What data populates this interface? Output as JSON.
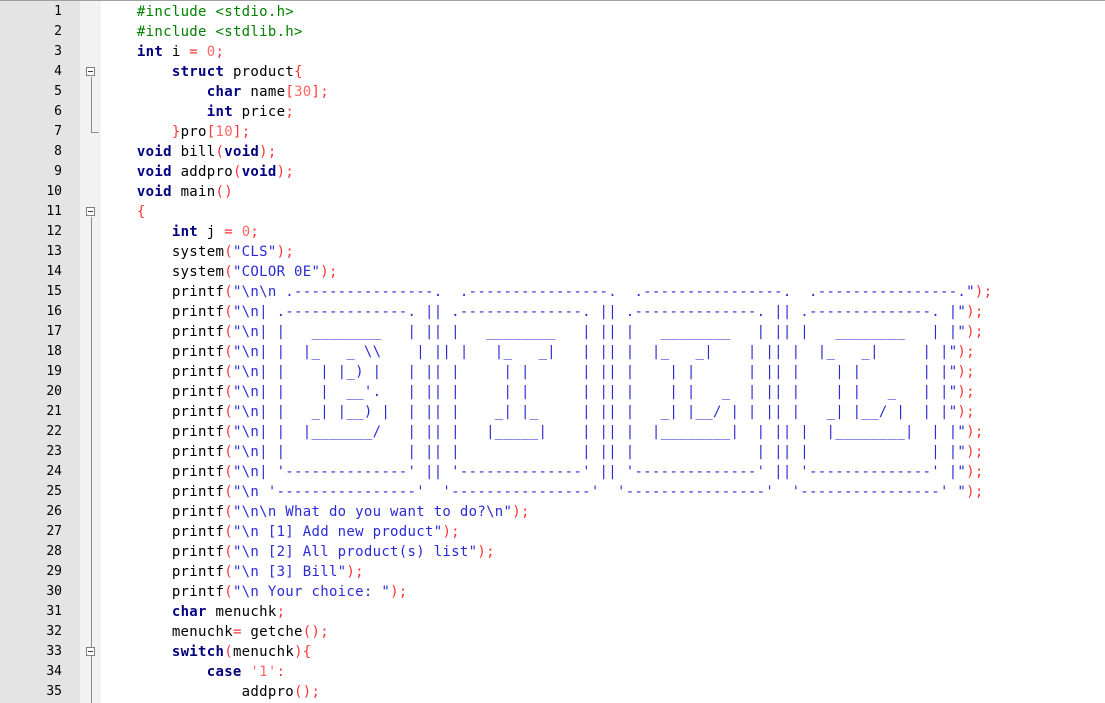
{
  "editor": {
    "lines": [
      {
        "n": "1",
        "tokens": [
          {
            "t": "    "
          },
          {
            "t": "#include <stdio.h>",
            "c": "pp"
          }
        ]
      },
      {
        "n": "2",
        "tokens": [
          {
            "t": "    "
          },
          {
            "t": "#include <stdlib.h>",
            "c": "pp"
          }
        ]
      },
      {
        "n": "3",
        "tokens": [
          {
            "t": "    "
          },
          {
            "t": "int",
            "c": "kw"
          },
          {
            "t": " i "
          },
          {
            "t": "=",
            "c": "op"
          },
          {
            "t": " "
          },
          {
            "t": "0",
            "c": "num"
          },
          {
            "t": ";",
            "c": "op"
          }
        ]
      },
      {
        "n": "4",
        "tokens": [
          {
            "t": "        "
          },
          {
            "t": "struct",
            "c": "kw"
          },
          {
            "t": " product"
          },
          {
            "t": "{",
            "c": "op"
          }
        ]
      },
      {
        "n": "5",
        "tokens": [
          {
            "t": "            "
          },
          {
            "t": "char",
            "c": "kw"
          },
          {
            "t": " name"
          },
          {
            "t": "[",
            "c": "op"
          },
          {
            "t": "30",
            "c": "num"
          },
          {
            "t": "];",
            "c": "op"
          }
        ]
      },
      {
        "n": "6",
        "tokens": [
          {
            "t": "            "
          },
          {
            "t": "int",
            "c": "kw"
          },
          {
            "t": " price"
          },
          {
            "t": ";",
            "c": "op"
          }
        ]
      },
      {
        "n": "7",
        "tokens": [
          {
            "t": "        "
          },
          {
            "t": "}",
            "c": "op"
          },
          {
            "t": "pro"
          },
          {
            "t": "[",
            "c": "op"
          },
          {
            "t": "10",
            "c": "num"
          },
          {
            "t": "];",
            "c": "op"
          }
        ]
      },
      {
        "n": "8",
        "tokens": [
          {
            "t": "    "
          },
          {
            "t": "void",
            "c": "kw"
          },
          {
            "t": " bill"
          },
          {
            "t": "(",
            "c": "op"
          },
          {
            "t": "void",
            "c": "kw"
          },
          {
            "t": ");",
            "c": "op"
          }
        ]
      },
      {
        "n": "9",
        "tokens": [
          {
            "t": "    "
          },
          {
            "t": "void",
            "c": "kw"
          },
          {
            "t": " addpro"
          },
          {
            "t": "(",
            "c": "op"
          },
          {
            "t": "void",
            "c": "kw"
          },
          {
            "t": ");",
            "c": "op"
          }
        ]
      },
      {
        "n": "10",
        "tokens": [
          {
            "t": "    "
          },
          {
            "t": "void",
            "c": "kw"
          },
          {
            "t": " main"
          },
          {
            "t": "()",
            "c": "op"
          }
        ]
      },
      {
        "n": "11",
        "tokens": [
          {
            "t": "    "
          },
          {
            "t": "{",
            "c": "op"
          }
        ]
      },
      {
        "n": "12",
        "tokens": [
          {
            "t": "        "
          },
          {
            "t": "int",
            "c": "kw"
          },
          {
            "t": " j "
          },
          {
            "t": "=",
            "c": "op"
          },
          {
            "t": " "
          },
          {
            "t": "0",
            "c": "num"
          },
          {
            "t": ";",
            "c": "op"
          }
        ]
      },
      {
        "n": "13",
        "tokens": [
          {
            "t": "        system"
          },
          {
            "t": "(",
            "c": "op"
          },
          {
            "t": "\"CLS\"",
            "c": "str"
          },
          {
            "t": ");",
            "c": "op"
          }
        ]
      },
      {
        "n": "14",
        "tokens": [
          {
            "t": "        system"
          },
          {
            "t": "(",
            "c": "op"
          },
          {
            "t": "\"COLOR 0E\"",
            "c": "str"
          },
          {
            "t": ");",
            "c": "op"
          }
        ]
      },
      {
        "n": "15",
        "tokens": [
          {
            "t": "        printf"
          },
          {
            "t": "(",
            "c": "op"
          },
          {
            "t": "\"\\n\\n .----------------.  .----------------.  .----------------.  .----------------.\"",
            "c": "str"
          },
          {
            "t": ");",
            "c": "op"
          }
        ]
      },
      {
        "n": "16",
        "tokens": [
          {
            "t": "        printf"
          },
          {
            "t": "(",
            "c": "op"
          },
          {
            "t": "\"\\n| .--------------. || .--------------. || .--------------. || .--------------. |\"",
            "c": "str"
          },
          {
            "t": ");",
            "c": "op"
          }
        ]
      },
      {
        "n": "17",
        "tokens": [
          {
            "t": "        printf"
          },
          {
            "t": "(",
            "c": "op"
          },
          {
            "t": "\"\\n| |   ________   | || |   ________   | || |   ________   | || |   ________   | |\"",
            "c": "str"
          },
          {
            "t": ");",
            "c": "op"
          }
        ]
      },
      {
        "n": "18",
        "tokens": [
          {
            "t": "        printf"
          },
          {
            "t": "(",
            "c": "op"
          },
          {
            "t": "\"\\n| |  |_   _ \\\\    | || |   |_   _|   | || |  |_   _|    | || |  |_   _|     | |\"",
            "c": "str"
          },
          {
            "t": ");",
            "c": "op"
          }
        ]
      },
      {
        "n": "19",
        "tokens": [
          {
            "t": "        printf"
          },
          {
            "t": "(",
            "c": "op"
          },
          {
            "t": "\"\\n| |    | |_) |   | || |     | |      | || |    | |      | || |    | |       | |\"",
            "c": "str"
          },
          {
            "t": ");",
            "c": "op"
          }
        ]
      },
      {
        "n": "20",
        "tokens": [
          {
            "t": "        printf"
          },
          {
            "t": "(",
            "c": "op"
          },
          {
            "t": "\"\\n| |    |  __'.   | || |     | |      | || |    | |   _  | || |    | |   _   | |\"",
            "c": "str"
          },
          {
            "t": ");",
            "c": "op"
          }
        ]
      },
      {
        "n": "21",
        "tokens": [
          {
            "t": "        printf"
          },
          {
            "t": "(",
            "c": "op"
          },
          {
            "t": "\"\\n| |   _| |__) |  | || |    _| |_     | || |   _| |__/ | | || |   _| |__/ |  | |\"",
            "c": "str"
          },
          {
            "t": ");",
            "c": "op"
          }
        ]
      },
      {
        "n": "22",
        "tokens": [
          {
            "t": "        printf"
          },
          {
            "t": "(",
            "c": "op"
          },
          {
            "t": "\"\\n| |  |_______/   | || |   |_____|    | || |  |________|  | || |  |________|  | |\"",
            "c": "str"
          },
          {
            "t": ");",
            "c": "op"
          }
        ]
      },
      {
        "n": "23",
        "tokens": [
          {
            "t": "        printf"
          },
          {
            "t": "(",
            "c": "op"
          },
          {
            "t": "\"\\n| |              | || |              | || |              | || |              | |\"",
            "c": "str"
          },
          {
            "t": ");",
            "c": "op"
          }
        ]
      },
      {
        "n": "24",
        "tokens": [
          {
            "t": "        printf"
          },
          {
            "t": "(",
            "c": "op"
          },
          {
            "t": "\"\\n| '--------------' || '--------------' || '--------------' || '--------------' |\"",
            "c": "str"
          },
          {
            "t": ");",
            "c": "op"
          }
        ]
      },
      {
        "n": "25",
        "tokens": [
          {
            "t": "        printf"
          },
          {
            "t": "(",
            "c": "op"
          },
          {
            "t": "\"\\n '----------------'  '----------------'  '----------------'  '----------------' \"",
            "c": "str"
          },
          {
            "t": ");",
            "c": "op"
          }
        ]
      },
      {
        "n": "26",
        "tokens": [
          {
            "t": "        printf"
          },
          {
            "t": "(",
            "c": "op"
          },
          {
            "t": "\"\\n\\n What do you want to do?\\n\"",
            "c": "str"
          },
          {
            "t": ");",
            "c": "op"
          }
        ]
      },
      {
        "n": "27",
        "tokens": [
          {
            "t": "        printf"
          },
          {
            "t": "(",
            "c": "op"
          },
          {
            "t": "\"\\n [1] Add new product\"",
            "c": "str"
          },
          {
            "t": ");",
            "c": "op"
          }
        ]
      },
      {
        "n": "28",
        "tokens": [
          {
            "t": "        printf"
          },
          {
            "t": "(",
            "c": "op"
          },
          {
            "t": "\"\\n [2] All product(s) list\"",
            "c": "str"
          },
          {
            "t": ");",
            "c": "op"
          }
        ]
      },
      {
        "n": "29",
        "tokens": [
          {
            "t": "        printf"
          },
          {
            "t": "(",
            "c": "op"
          },
          {
            "t": "\"\\n [3] Bill\"",
            "c": "str"
          },
          {
            "t": ");",
            "c": "op"
          }
        ]
      },
      {
        "n": "30",
        "tokens": [
          {
            "t": "        printf"
          },
          {
            "t": "(",
            "c": "op"
          },
          {
            "t": "\"\\n Your choice: \"",
            "c": "str"
          },
          {
            "t": ");",
            "c": "op"
          }
        ]
      },
      {
        "n": "31",
        "tokens": [
          {
            "t": "        "
          },
          {
            "t": "char",
            "c": "kw"
          },
          {
            "t": " menuchk"
          },
          {
            "t": ";",
            "c": "op"
          }
        ]
      },
      {
        "n": "32",
        "tokens": [
          {
            "t": "        menuchk"
          },
          {
            "t": "=",
            "c": "op"
          },
          {
            "t": " getche"
          },
          {
            "t": "();",
            "c": "op"
          }
        ]
      },
      {
        "n": "33",
        "tokens": [
          {
            "t": "        "
          },
          {
            "t": "switch",
            "c": "kw"
          },
          {
            "t": "(",
            "c": "op"
          },
          {
            "t": "menuchk"
          },
          {
            "t": "){",
            "c": "op"
          }
        ]
      },
      {
        "n": "34",
        "tokens": [
          {
            "t": "            "
          },
          {
            "t": "case",
            "c": "kw"
          },
          {
            "t": " "
          },
          {
            "t": "'1'",
            "c": "num"
          },
          {
            "t": ":",
            "c": "op"
          }
        ]
      },
      {
        "n": "35",
        "tokens": [
          {
            "t": "                addpro"
          },
          {
            "t": "();",
            "c": "op"
          }
        ]
      }
    ]
  }
}
